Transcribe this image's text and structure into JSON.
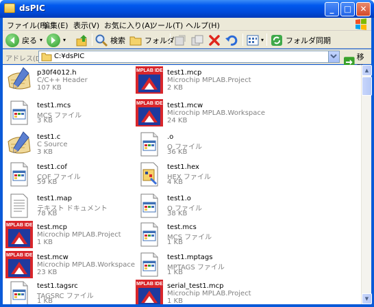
{
  "window": {
    "title": "dsPIC"
  },
  "menu": [
    "ファイル(F)",
    "編集(E)",
    "表示(V)",
    "お気に入り(A)",
    "ツール(T)",
    "ヘルプ(H)"
  ],
  "toolbar": {
    "back_label": "戻る",
    "search_label": "検索",
    "folders_label": "フォルダ",
    "sync_label": "フォルダ同期"
  },
  "address": {
    "label": "アドレス(D)",
    "path": "C:¥dsPIC",
    "go_label": "移動"
  },
  "files": [
    {
      "name": "p30f4012.h",
      "type": "C/C++ Header",
      "size": "107 KB",
      "icon": "c-source-icon"
    },
    {
      "name": "test1.mcp",
      "type": "Microchip MPLAB.Project",
      "size": "2 KB",
      "icon": "mplab-icon"
    },
    {
      "name": "test1.mcs",
      "type": "MCS ファイル",
      "size": "3 KB",
      "icon": "generic-file-icon"
    },
    {
      "name": "test1.mcw",
      "type": "Microchip MPLAB.Workspace",
      "size": "24 KB",
      "icon": "mplab-icon"
    },
    {
      "name": "test1.c",
      "type": "C Source",
      "size": "3 KB",
      "icon": "c-source-icon"
    },
    {
      "name": ".o",
      "type": "O ファイル",
      "size": "36 KB",
      "icon": "generic-file-icon"
    },
    {
      "name": "test1.cof",
      "type": "COF ファイル",
      "size": "59 KB",
      "icon": "generic-file-icon"
    },
    {
      "name": "test1.hex",
      "type": "HEX ファイル",
      "size": "4 KB",
      "icon": "hex-file-icon"
    },
    {
      "name": "test1.map",
      "type": "テキスト ドキュメント",
      "size": "78 KB",
      "icon": "text-doc-icon"
    },
    {
      "name": "test1.o",
      "type": "O ファイル",
      "size": "38 KB",
      "icon": "generic-file-icon"
    },
    {
      "name": "test.mcp",
      "type": "Microchip MPLAB.Project",
      "size": "1 KB",
      "icon": "mplab-icon"
    },
    {
      "name": "test.mcs",
      "type": "MCS ファイル",
      "size": "1 KB",
      "icon": "generic-file-icon"
    },
    {
      "name": "test.mcw",
      "type": "Microchip MPLAB.Workspace",
      "size": "23 KB",
      "icon": "mplab-icon"
    },
    {
      "name": "test1.mptags",
      "type": "MPTAGS ファイル",
      "size": "1 KB",
      "icon": "generic-file-icon"
    },
    {
      "name": "test1.tagsrc",
      "type": "TAGSRC ファイル",
      "size": "1 KB",
      "icon": "generic-file-icon"
    },
    {
      "name": "serial_test1.mcp",
      "type": "Microchip MPLAB.Project",
      "size": "1 KB",
      "icon": "mplab-icon"
    }
  ],
  "mplab_logo_text": "MPLAB IDE",
  "colors": {
    "titlebar": "#0058ee",
    "chrome": "#ece9d8",
    "mplab_red": "#d8262b"
  }
}
